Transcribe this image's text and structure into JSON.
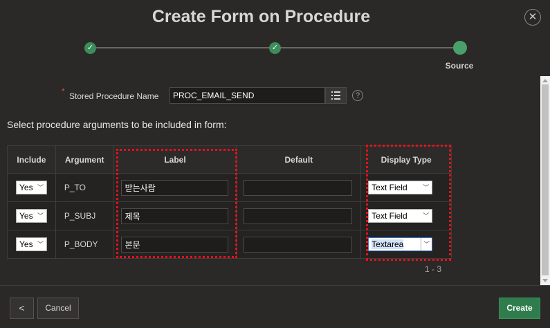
{
  "dialog": {
    "title": "Create Form on Procedure",
    "close_glyph": "✕"
  },
  "wizard": {
    "steps": [
      {
        "state": "done",
        "icon": "check-icon",
        "glyph": "✓"
      },
      {
        "state": "done",
        "icon": "check-icon",
        "glyph": "✓"
      },
      {
        "state": "current",
        "label": "Source"
      }
    ]
  },
  "form": {
    "required_marker": "*",
    "stored_procedure_label": "Stored Procedure Name",
    "stored_procedure_value": "PROC_EMAIL_SEND",
    "help_glyph": "?",
    "section_text": "Select procedure arguments to be included in form:"
  },
  "table": {
    "headers": {
      "include": "Include",
      "argument": "Argument",
      "label": "Label",
      "default": "Default",
      "display_type": "Display Type"
    },
    "rows": [
      {
        "include": "Yes",
        "argument": "P_TO",
        "label": "받는사람",
        "default": "",
        "display_type": "Text Field"
      },
      {
        "include": "Yes",
        "argument": "P_SUBJ",
        "label": "제목",
        "default": "",
        "display_type": "Text Field"
      },
      {
        "include": "Yes",
        "argument": "P_BODY",
        "label": "본문",
        "default": "",
        "display_type": "Textarea"
      }
    ],
    "pagination": "1 - 3"
  },
  "footer": {
    "back_glyph": "<",
    "cancel_label": "Cancel",
    "create_label": "Create"
  },
  "colors": {
    "background": "#2b2927",
    "accent_green": "#2f7d4c",
    "highlight_red": "#e8101a"
  }
}
